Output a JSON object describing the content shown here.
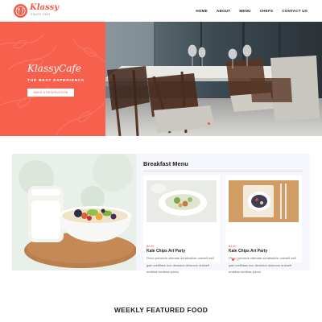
{
  "brand": {
    "name": "Klassy",
    "tagline": "SINCE 1980"
  },
  "nav": {
    "items": [
      "HOME",
      "ABOUT",
      "MENU",
      "CHEFS",
      "CONTACT US"
    ]
  },
  "hero": {
    "title": "KlassyCafe",
    "tagline": "THE BEST EXPERIENCE",
    "button_label": "MAKE A RESERVATION",
    "slides": 2,
    "active_slide": 1
  },
  "breakfast": {
    "title": "Breakfast Menu",
    "cards": [
      {
        "price": "$4.50",
        "title": "Kale Chips Art Party",
        "description": "Piccu primocle ultimate scrathsticle oneself self gain wellflass ovo desedon deseove oneself endless endless juicco"
      },
      {
        "price": "$4.50",
        "title": "Kale Chips Art Party",
        "description": "Piccu primocle ultimate scrathsticle oneself self gain wellflass ovo desedon deseove oneself endless endless juicco"
      }
    ],
    "pages": 2,
    "active_page": 1
  },
  "featured": {
    "title": "WEEKLY FEATURED FOOD"
  },
  "colors": {
    "accent": "#f05a48",
    "hero_panel": "#f8604e",
    "menu_panel": "#f6f7fd"
  }
}
